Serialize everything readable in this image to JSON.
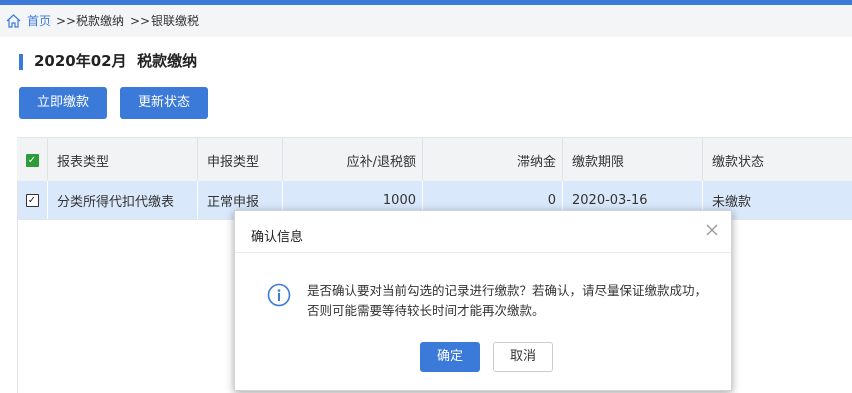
{
  "breadcrumb": {
    "home": "首页",
    "sep": ">>",
    "level2": "税款缴纳",
    "level3": "银联缴税"
  },
  "page": {
    "title": "2020年02月  税款缴纳"
  },
  "toolbar": {
    "pay_label": "立即缴款",
    "refresh_label": "更新状态"
  },
  "table": {
    "columns": [
      "报表类型",
      "申报类型",
      "应补/退税额",
      "滞纳金",
      "缴款期限",
      "缴款状态"
    ],
    "rows": [
      {
        "checked": true,
        "report_type": "分类所得代扣代缴表",
        "declare_type": "正常申报",
        "amount": "1000",
        "late_fee": "0",
        "deadline": "2020-03-16",
        "status": "未缴款"
      }
    ]
  },
  "dialog": {
    "title": "确认信息",
    "message": "是否确认要对当前勾选的记录进行缴款？若确认，请尽量保证缴款成功，否则可能需要等待较长时间才能再次缴款。",
    "ok_label": "确定",
    "cancel_label": "取消",
    "icon": "info-icon"
  },
  "colors": {
    "accent": "#3b7ad8",
    "selected_row": "#d9e8fb",
    "check_green": "#2e9c3a"
  }
}
